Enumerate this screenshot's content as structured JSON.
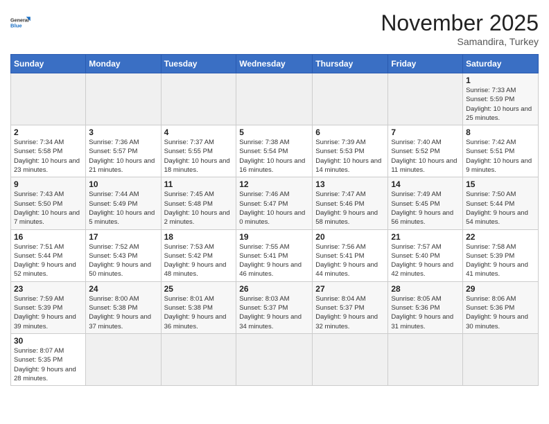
{
  "logo": {
    "line1": "General",
    "line2": "Blue"
  },
  "title": "November 2025",
  "subtitle": "Samandira, Turkey",
  "days_of_week": [
    "Sunday",
    "Monday",
    "Tuesday",
    "Wednesday",
    "Thursday",
    "Friday",
    "Saturday"
  ],
  "weeks": [
    [
      {
        "day": "",
        "info": ""
      },
      {
        "day": "",
        "info": ""
      },
      {
        "day": "",
        "info": ""
      },
      {
        "day": "",
        "info": ""
      },
      {
        "day": "",
        "info": ""
      },
      {
        "day": "",
        "info": ""
      },
      {
        "day": "1",
        "info": "Sunrise: 7:33 AM\nSunset: 5:59 PM\nDaylight: 10 hours and 25 minutes."
      }
    ],
    [
      {
        "day": "2",
        "info": "Sunrise: 7:34 AM\nSunset: 5:58 PM\nDaylight: 10 hours and 23 minutes."
      },
      {
        "day": "3",
        "info": "Sunrise: 7:36 AM\nSunset: 5:57 PM\nDaylight: 10 hours and 21 minutes."
      },
      {
        "day": "4",
        "info": "Sunrise: 7:37 AM\nSunset: 5:55 PM\nDaylight: 10 hours and 18 minutes."
      },
      {
        "day": "5",
        "info": "Sunrise: 7:38 AM\nSunset: 5:54 PM\nDaylight: 10 hours and 16 minutes."
      },
      {
        "day": "6",
        "info": "Sunrise: 7:39 AM\nSunset: 5:53 PM\nDaylight: 10 hours and 14 minutes."
      },
      {
        "day": "7",
        "info": "Sunrise: 7:40 AM\nSunset: 5:52 PM\nDaylight: 10 hours and 11 minutes."
      },
      {
        "day": "8",
        "info": "Sunrise: 7:42 AM\nSunset: 5:51 PM\nDaylight: 10 hours and 9 minutes."
      }
    ],
    [
      {
        "day": "9",
        "info": "Sunrise: 7:43 AM\nSunset: 5:50 PM\nDaylight: 10 hours and 7 minutes."
      },
      {
        "day": "10",
        "info": "Sunrise: 7:44 AM\nSunset: 5:49 PM\nDaylight: 10 hours and 5 minutes."
      },
      {
        "day": "11",
        "info": "Sunrise: 7:45 AM\nSunset: 5:48 PM\nDaylight: 10 hours and 2 minutes."
      },
      {
        "day": "12",
        "info": "Sunrise: 7:46 AM\nSunset: 5:47 PM\nDaylight: 10 hours and 0 minutes."
      },
      {
        "day": "13",
        "info": "Sunrise: 7:47 AM\nSunset: 5:46 PM\nDaylight: 9 hours and 58 minutes."
      },
      {
        "day": "14",
        "info": "Sunrise: 7:49 AM\nSunset: 5:45 PM\nDaylight: 9 hours and 56 minutes."
      },
      {
        "day": "15",
        "info": "Sunrise: 7:50 AM\nSunset: 5:44 PM\nDaylight: 9 hours and 54 minutes."
      }
    ],
    [
      {
        "day": "16",
        "info": "Sunrise: 7:51 AM\nSunset: 5:44 PM\nDaylight: 9 hours and 52 minutes."
      },
      {
        "day": "17",
        "info": "Sunrise: 7:52 AM\nSunset: 5:43 PM\nDaylight: 9 hours and 50 minutes."
      },
      {
        "day": "18",
        "info": "Sunrise: 7:53 AM\nSunset: 5:42 PM\nDaylight: 9 hours and 48 minutes."
      },
      {
        "day": "19",
        "info": "Sunrise: 7:55 AM\nSunset: 5:41 PM\nDaylight: 9 hours and 46 minutes."
      },
      {
        "day": "20",
        "info": "Sunrise: 7:56 AM\nSunset: 5:41 PM\nDaylight: 9 hours and 44 minutes."
      },
      {
        "day": "21",
        "info": "Sunrise: 7:57 AM\nSunset: 5:40 PM\nDaylight: 9 hours and 42 minutes."
      },
      {
        "day": "22",
        "info": "Sunrise: 7:58 AM\nSunset: 5:39 PM\nDaylight: 9 hours and 41 minutes."
      }
    ],
    [
      {
        "day": "23",
        "info": "Sunrise: 7:59 AM\nSunset: 5:39 PM\nDaylight: 9 hours and 39 minutes."
      },
      {
        "day": "24",
        "info": "Sunrise: 8:00 AM\nSunset: 5:38 PM\nDaylight: 9 hours and 37 minutes."
      },
      {
        "day": "25",
        "info": "Sunrise: 8:01 AM\nSunset: 5:38 PM\nDaylight: 9 hours and 36 minutes."
      },
      {
        "day": "26",
        "info": "Sunrise: 8:03 AM\nSunset: 5:37 PM\nDaylight: 9 hours and 34 minutes."
      },
      {
        "day": "27",
        "info": "Sunrise: 8:04 AM\nSunset: 5:37 PM\nDaylight: 9 hours and 32 minutes."
      },
      {
        "day": "28",
        "info": "Sunrise: 8:05 AM\nSunset: 5:36 PM\nDaylight: 9 hours and 31 minutes."
      },
      {
        "day": "29",
        "info": "Sunrise: 8:06 AM\nSunset: 5:36 PM\nDaylight: 9 hours and 30 minutes."
      }
    ],
    [
      {
        "day": "30",
        "info": "Sunrise: 8:07 AM\nSunset: 5:35 PM\nDaylight: 9 hours and 28 minutes."
      },
      {
        "day": "",
        "info": ""
      },
      {
        "day": "",
        "info": ""
      },
      {
        "day": "",
        "info": ""
      },
      {
        "day": "",
        "info": ""
      },
      {
        "day": "",
        "info": ""
      },
      {
        "day": "",
        "info": ""
      }
    ]
  ]
}
